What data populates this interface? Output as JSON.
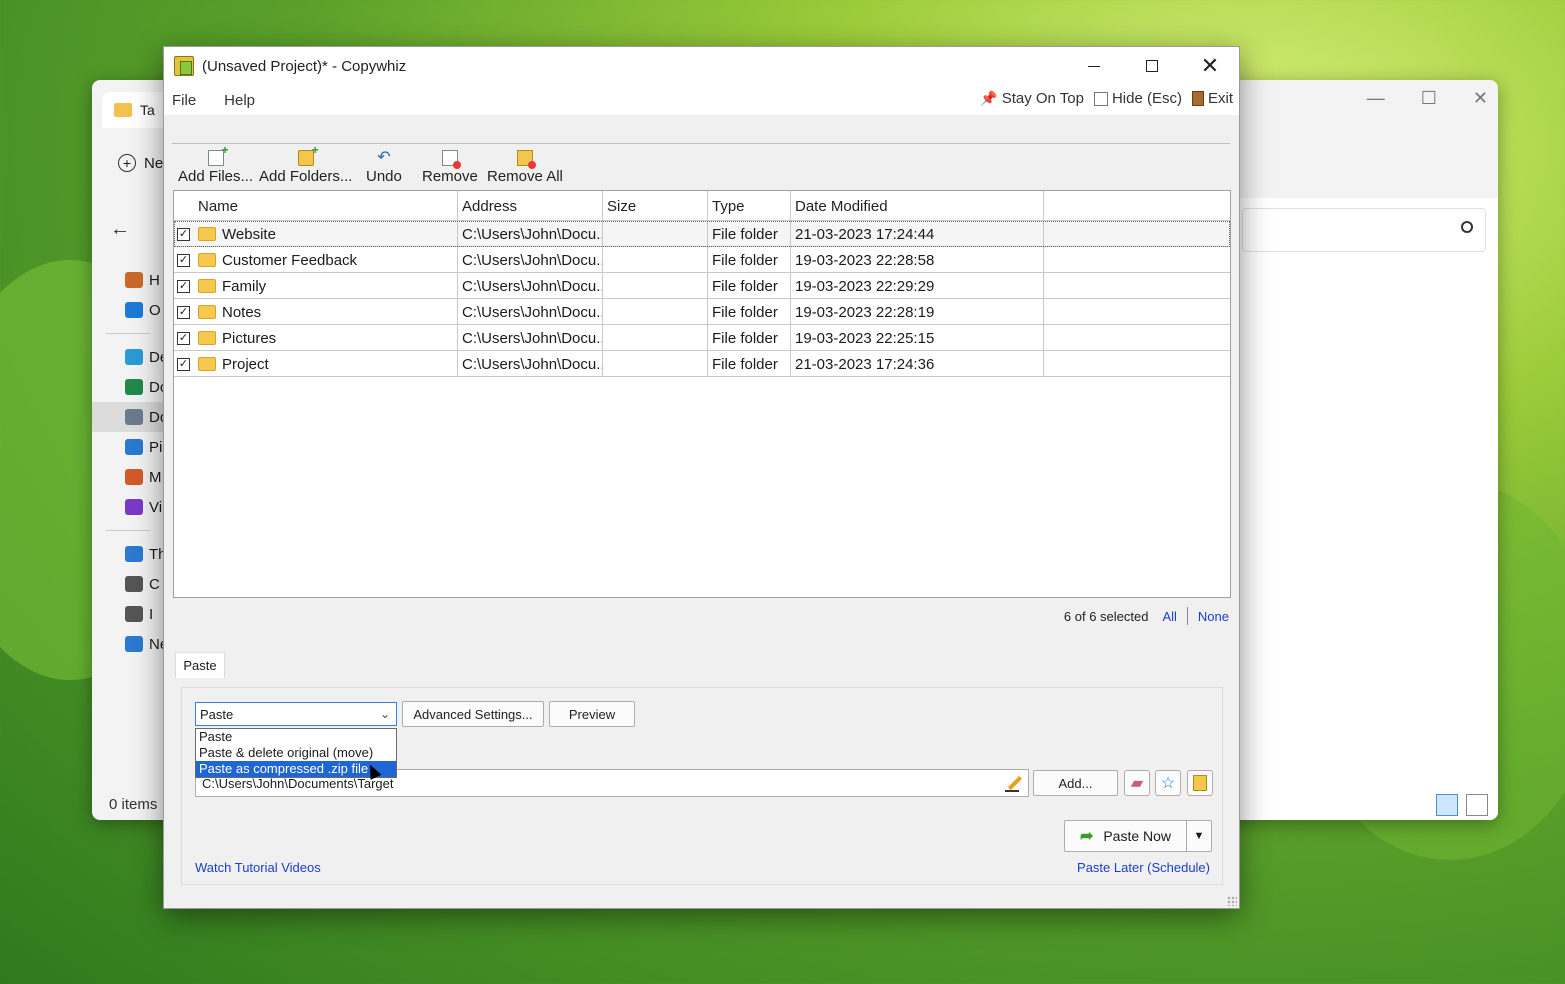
{
  "explorer": {
    "tab_label": "Ta",
    "new_label": "Ne",
    "nav": [
      {
        "label": "H",
        "icon": "home-icon",
        "color": "#c96a2a"
      },
      {
        "label": "O",
        "icon": "cloud-icon",
        "color": "#1d7bd8"
      },
      {
        "label": "De",
        "icon": "desktop-icon",
        "color": "#2a9bd6"
      },
      {
        "label": "Do",
        "icon": "download-icon",
        "color": "#1f8a4c"
      },
      {
        "label": "Do",
        "icon": "documents-icon",
        "color": "#6a7b8c"
      },
      {
        "label": "Pi",
        "icon": "pictures-icon",
        "color": "#2a7ad1"
      },
      {
        "label": "M",
        "icon": "music-icon",
        "color": "#d35a2a"
      },
      {
        "label": "Vi",
        "icon": "videos-icon",
        "color": "#7a3ac8"
      }
    ],
    "nav2": [
      {
        "label": "Th",
        "icon": "this-pc-icon",
        "color": "#2a7ad1"
      },
      {
        "label": "C",
        "icon": "drive-icon",
        "color": "#555555"
      },
      {
        "label": "I",
        "icon": "drive-icon",
        "color": "#555555"
      },
      {
        "label": "Ne",
        "icon": "network-icon",
        "color": "#2a7ad1"
      }
    ],
    "items_count": "0 items"
  },
  "window": {
    "title": "(Unsaved Project)* - Copywhiz"
  },
  "menu": {
    "file": "File",
    "help": "Help",
    "stay_on_top": "Stay On Top",
    "hide": "Hide (Esc)",
    "exit": "Exit"
  },
  "toolbar": {
    "add_files": "Add Files...",
    "add_folders": "Add Folders...",
    "undo": "Undo",
    "remove": "Remove",
    "remove_all": "Remove All"
  },
  "table": {
    "columns": [
      "Name",
      "Address",
      "Size",
      "Type",
      "Date Modified"
    ],
    "rows": [
      {
        "checked": true,
        "name": "Website",
        "address": "C:\\Users\\John\\Docu...",
        "size": "",
        "type": "File folder",
        "date": "21-03-2023 17:24:44"
      },
      {
        "checked": true,
        "name": "Customer Feedback",
        "address": "C:\\Users\\John\\Docu...",
        "size": "",
        "type": "File folder",
        "date": "19-03-2023 22:28:58"
      },
      {
        "checked": true,
        "name": "Family",
        "address": "C:\\Users\\John\\Docu...",
        "size": "",
        "type": "File folder",
        "date": "19-03-2023 22:29:29"
      },
      {
        "checked": true,
        "name": "Notes",
        "address": "C:\\Users\\John\\Docu...",
        "size": "",
        "type": "File folder",
        "date": "19-03-2023 22:28:19"
      },
      {
        "checked": true,
        "name": "Pictures",
        "address": "C:\\Users\\John\\Docu...",
        "size": "",
        "type": "File folder",
        "date": "19-03-2023 22:25:15"
      },
      {
        "checked": true,
        "name": "Project",
        "address": "C:\\Users\\John\\Docu...",
        "size": "",
        "type": "File folder",
        "date": "21-03-2023 17:24:36"
      }
    ]
  },
  "selection": {
    "count": "6 of 6 selected",
    "all": "All",
    "none": "None"
  },
  "paste_panel": {
    "tab_label": "Paste",
    "mode_selected": "Paste",
    "mode_options": [
      "Paste",
      "Paste & delete original (move)",
      "Paste as compressed .zip file"
    ],
    "highlighted_option": 2,
    "advanced_settings": "Advanced Settings...",
    "preview": "Preview",
    "destination": "C:\\Users\\John\\Documents\\Target",
    "add": "Add...",
    "paste_now": "Paste Now",
    "tutorial_link": "Watch Tutorial Videos",
    "paste_later_link": "Paste Later (Schedule)"
  },
  "colors": {
    "link": "#1a3fc8",
    "highlight": "#1e66d6",
    "folder": "#f6c94e"
  }
}
